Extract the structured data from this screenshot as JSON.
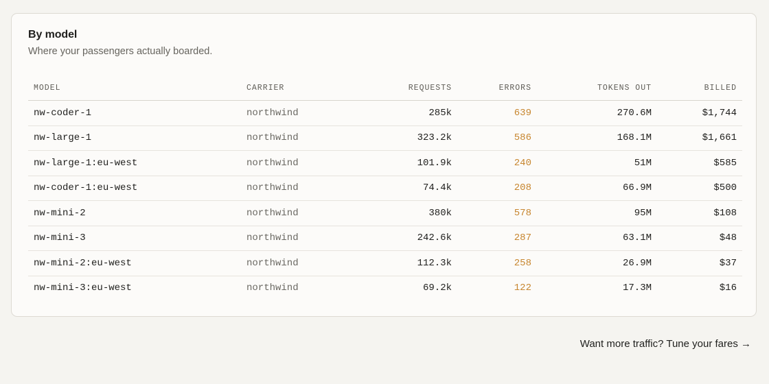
{
  "card": {
    "title": "By model",
    "subtitle": "Where your passengers actually boarded."
  },
  "table": {
    "columns": [
      "MODEL",
      "CARRIER",
      "REQUESTS",
      "ERRORS",
      "TOKENS OUT",
      "BILLED"
    ],
    "rows": [
      {
        "model": "nw-coder-1",
        "carrier": "northwind",
        "requests": "285k",
        "errors": "639",
        "tokens_out": "270.6M",
        "billed": "$1,744"
      },
      {
        "model": "nw-large-1",
        "carrier": "northwind",
        "requests": "323.2k",
        "errors": "586",
        "tokens_out": "168.1M",
        "billed": "$1,661"
      },
      {
        "model": "nw-large-1:eu-west",
        "carrier": "northwind",
        "requests": "101.9k",
        "errors": "240",
        "tokens_out": "51M",
        "billed": "$585"
      },
      {
        "model": "nw-coder-1:eu-west",
        "carrier": "northwind",
        "requests": "74.4k",
        "errors": "208",
        "tokens_out": "66.9M",
        "billed": "$500"
      },
      {
        "model": "nw-mini-2",
        "carrier": "northwind",
        "requests": "380k",
        "errors": "578",
        "tokens_out": "95M",
        "billed": "$108"
      },
      {
        "model": "nw-mini-3",
        "carrier": "northwind",
        "requests": "242.6k",
        "errors": "287",
        "tokens_out": "63.1M",
        "billed": "$48"
      },
      {
        "model": "nw-mini-2:eu-west",
        "carrier": "northwind",
        "requests": "112.3k",
        "errors": "258",
        "tokens_out": "26.9M",
        "billed": "$37"
      },
      {
        "model": "nw-mini-3:eu-west",
        "carrier": "northwind",
        "requests": "69.2k",
        "errors": "122",
        "tokens_out": "17.3M",
        "billed": "$16"
      }
    ]
  },
  "footer": {
    "link_text": "Want more traffic? Tune your fares →"
  },
  "colors": {
    "background": "#f5f4f0",
    "card": "#fcfbf9",
    "error_accent": "#c7862f",
    "text": "#1f1f1d",
    "muted": "#66645e"
  }
}
